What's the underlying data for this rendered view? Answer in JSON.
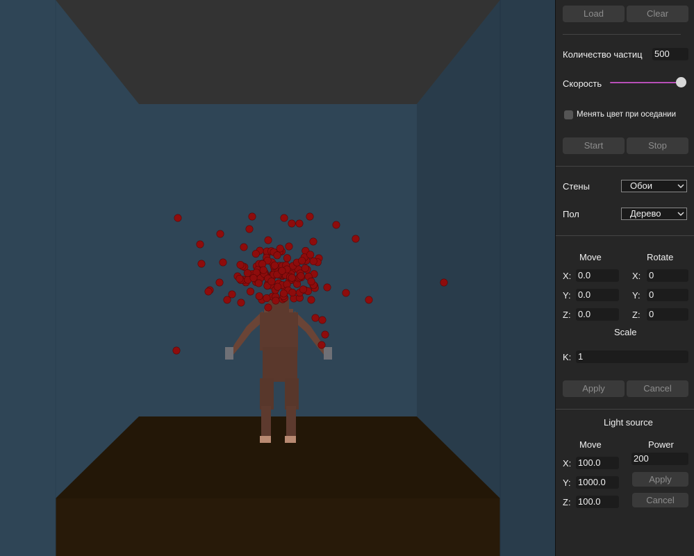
{
  "colors": {
    "ceiling": "#333333",
    "back_wall": "#2f4556",
    "left_wall": "#2f4556",
    "right_wall": "#293c4b",
    "floor": "#231707",
    "floor_front": "#281a09",
    "particle": "#8e0c0c",
    "figure": "#5d3a2e",
    "slider_accent": "#b84fb8"
  },
  "toolbar": {
    "load_label": "Load",
    "clear_label": "Clear"
  },
  "particles": {
    "count_label": "Количество частиц",
    "count_value": "500",
    "speed_label": "Скорость",
    "speed_value": 1.0,
    "color_change_label": "Менять цвет при оседании",
    "color_change_checked": false,
    "start_label": "Start",
    "stop_label": "Stop"
  },
  "materials": {
    "walls_label": "Стены",
    "walls_value": "Обои",
    "floor_label": "Пол",
    "floor_value": "Дерево"
  },
  "transform": {
    "move_header": "Move",
    "rotate_header": "Rotate",
    "x_label": "X:",
    "y_label": "Y:",
    "z_label": "Z:",
    "move": {
      "x": "0.0",
      "y": "0.0",
      "z": "0.0"
    },
    "rotate": {
      "x": "0",
      "y": "0",
      "z": "0"
    },
    "scale_header": "Scale",
    "k_label": "K:",
    "k_value": "1",
    "apply_label": "Apply",
    "cancel_label": "Cancel"
  },
  "light": {
    "title": "Light source",
    "move_header": "Move",
    "power_header": "Power",
    "x_label": "X:",
    "y_label": "Y:",
    "z_label": "Z:",
    "move": {
      "x": "100.0",
      "y": "1000.0",
      "z": "100.0"
    },
    "power_value": "200",
    "apply_label": "Apply",
    "cancel_label": "Cancel"
  }
}
